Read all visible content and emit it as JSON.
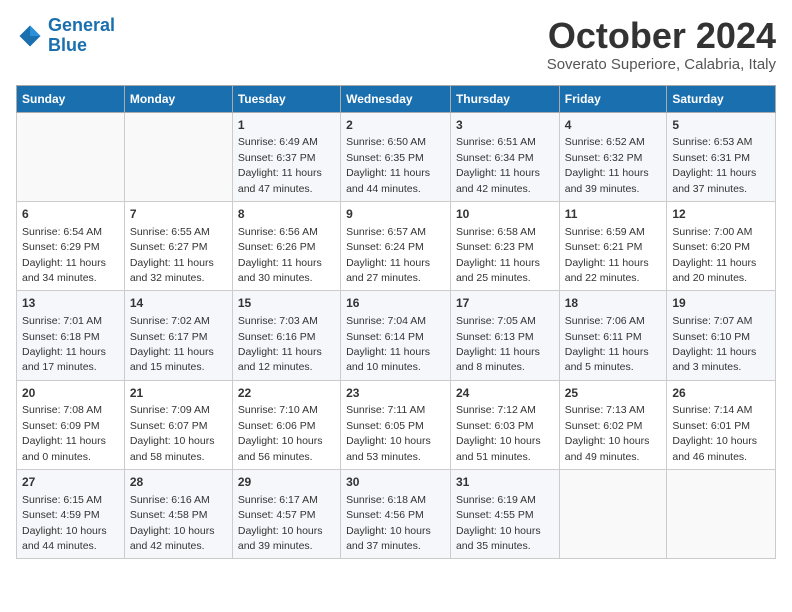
{
  "logo": {
    "line1": "General",
    "line2": "Blue"
  },
  "title": "October 2024",
  "subtitle": "Soverato Superiore, Calabria, Italy",
  "days_header": [
    "Sunday",
    "Monday",
    "Tuesday",
    "Wednesday",
    "Thursday",
    "Friday",
    "Saturday"
  ],
  "weeks": [
    [
      {
        "num": "",
        "detail": ""
      },
      {
        "num": "",
        "detail": ""
      },
      {
        "num": "1",
        "detail": "Sunrise: 6:49 AM\nSunset: 6:37 PM\nDaylight: 11 hours and 47 minutes."
      },
      {
        "num": "2",
        "detail": "Sunrise: 6:50 AM\nSunset: 6:35 PM\nDaylight: 11 hours and 44 minutes."
      },
      {
        "num": "3",
        "detail": "Sunrise: 6:51 AM\nSunset: 6:34 PM\nDaylight: 11 hours and 42 minutes."
      },
      {
        "num": "4",
        "detail": "Sunrise: 6:52 AM\nSunset: 6:32 PM\nDaylight: 11 hours and 39 minutes."
      },
      {
        "num": "5",
        "detail": "Sunrise: 6:53 AM\nSunset: 6:31 PM\nDaylight: 11 hours and 37 minutes."
      }
    ],
    [
      {
        "num": "6",
        "detail": "Sunrise: 6:54 AM\nSunset: 6:29 PM\nDaylight: 11 hours and 34 minutes."
      },
      {
        "num": "7",
        "detail": "Sunrise: 6:55 AM\nSunset: 6:27 PM\nDaylight: 11 hours and 32 minutes."
      },
      {
        "num": "8",
        "detail": "Sunrise: 6:56 AM\nSunset: 6:26 PM\nDaylight: 11 hours and 30 minutes."
      },
      {
        "num": "9",
        "detail": "Sunrise: 6:57 AM\nSunset: 6:24 PM\nDaylight: 11 hours and 27 minutes."
      },
      {
        "num": "10",
        "detail": "Sunrise: 6:58 AM\nSunset: 6:23 PM\nDaylight: 11 hours and 25 minutes."
      },
      {
        "num": "11",
        "detail": "Sunrise: 6:59 AM\nSunset: 6:21 PM\nDaylight: 11 hours and 22 minutes."
      },
      {
        "num": "12",
        "detail": "Sunrise: 7:00 AM\nSunset: 6:20 PM\nDaylight: 11 hours and 20 minutes."
      }
    ],
    [
      {
        "num": "13",
        "detail": "Sunrise: 7:01 AM\nSunset: 6:18 PM\nDaylight: 11 hours and 17 minutes."
      },
      {
        "num": "14",
        "detail": "Sunrise: 7:02 AM\nSunset: 6:17 PM\nDaylight: 11 hours and 15 minutes."
      },
      {
        "num": "15",
        "detail": "Sunrise: 7:03 AM\nSunset: 6:16 PM\nDaylight: 11 hours and 12 minutes."
      },
      {
        "num": "16",
        "detail": "Sunrise: 7:04 AM\nSunset: 6:14 PM\nDaylight: 11 hours and 10 minutes."
      },
      {
        "num": "17",
        "detail": "Sunrise: 7:05 AM\nSunset: 6:13 PM\nDaylight: 11 hours and 8 minutes."
      },
      {
        "num": "18",
        "detail": "Sunrise: 7:06 AM\nSunset: 6:11 PM\nDaylight: 11 hours and 5 minutes."
      },
      {
        "num": "19",
        "detail": "Sunrise: 7:07 AM\nSunset: 6:10 PM\nDaylight: 11 hours and 3 minutes."
      }
    ],
    [
      {
        "num": "20",
        "detail": "Sunrise: 7:08 AM\nSunset: 6:09 PM\nDaylight: 11 hours and 0 minutes."
      },
      {
        "num": "21",
        "detail": "Sunrise: 7:09 AM\nSunset: 6:07 PM\nDaylight: 10 hours and 58 minutes."
      },
      {
        "num": "22",
        "detail": "Sunrise: 7:10 AM\nSunset: 6:06 PM\nDaylight: 10 hours and 56 minutes."
      },
      {
        "num": "23",
        "detail": "Sunrise: 7:11 AM\nSunset: 6:05 PM\nDaylight: 10 hours and 53 minutes."
      },
      {
        "num": "24",
        "detail": "Sunrise: 7:12 AM\nSunset: 6:03 PM\nDaylight: 10 hours and 51 minutes."
      },
      {
        "num": "25",
        "detail": "Sunrise: 7:13 AM\nSunset: 6:02 PM\nDaylight: 10 hours and 49 minutes."
      },
      {
        "num": "26",
        "detail": "Sunrise: 7:14 AM\nSunset: 6:01 PM\nDaylight: 10 hours and 46 minutes."
      }
    ],
    [
      {
        "num": "27",
        "detail": "Sunrise: 6:15 AM\nSunset: 4:59 PM\nDaylight: 10 hours and 44 minutes."
      },
      {
        "num": "28",
        "detail": "Sunrise: 6:16 AM\nSunset: 4:58 PM\nDaylight: 10 hours and 42 minutes."
      },
      {
        "num": "29",
        "detail": "Sunrise: 6:17 AM\nSunset: 4:57 PM\nDaylight: 10 hours and 39 minutes."
      },
      {
        "num": "30",
        "detail": "Sunrise: 6:18 AM\nSunset: 4:56 PM\nDaylight: 10 hours and 37 minutes."
      },
      {
        "num": "31",
        "detail": "Sunrise: 6:19 AM\nSunset: 4:55 PM\nDaylight: 10 hours and 35 minutes."
      },
      {
        "num": "",
        "detail": ""
      },
      {
        "num": "",
        "detail": ""
      }
    ]
  ]
}
